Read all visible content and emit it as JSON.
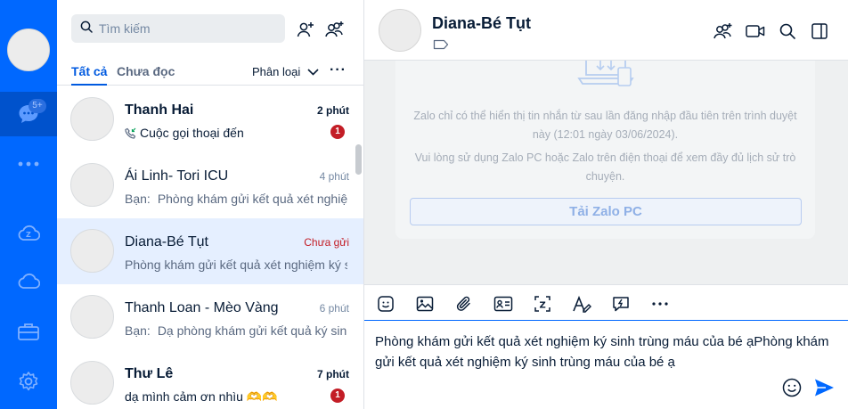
{
  "rail": {
    "message_badge": "5+"
  },
  "search": {
    "placeholder": "Tìm kiếm"
  },
  "filters": {
    "tab_all": "Tất cả",
    "tab_unread": "Chưa đọc",
    "classify": "Phân loại"
  },
  "conversations": [
    {
      "name": "Thanh Hai",
      "time": "2 phút",
      "preview": "Cuộc gọi thoại đến",
      "unread_count": "1"
    },
    {
      "name": "Ái Linh- Tori ICU",
      "time": "4 phút",
      "prefix": "Bạn:",
      "preview": "Phòng khám gửi kết quả xét nghiệm"
    },
    {
      "name": "Diana-Bé Tụt",
      "time": "Chưa gửi",
      "preview": "Phòng khám gửi kết quả xét nghiệm ký sinh trùng máu"
    },
    {
      "name": "Thanh Loan - Mèo Vàng",
      "time": "6 phút",
      "prefix": "Bạn:",
      "preview": "Dạ phòng khám gửi kết quả ký sinh"
    },
    {
      "name": "Thư Lê",
      "time": "7 phút",
      "preview": "dạ mình cảm ơn nhìu 🫶🫶",
      "unread_count": "1"
    }
  ],
  "chat": {
    "title": "Diana-Bé Tụt",
    "notice_line1": "Zalo chỉ có thể hiển thị tin nhắn từ sau lần đăng nhập đầu tiên trên trình duyệt này (12:01 ngày 03/06/2024).",
    "notice_line2": "Vui lòng sử dụng Zalo PC hoặc Zalo trên điện thoại để xem đầy đủ lịch sử trò chuyện.",
    "download_button": "Tải Zalo PC",
    "draft": "Phòng khám gửi kết quả xét nghiệm ký sinh trùng máu của bé ạPhòng khám gửi kết quả xét nghiệm ký sinh trùng máu của bé ạ"
  },
  "colors": {
    "brand": "#0068ff",
    "unread_badge": "#c31d26",
    "selected_row": "#e5efff"
  }
}
